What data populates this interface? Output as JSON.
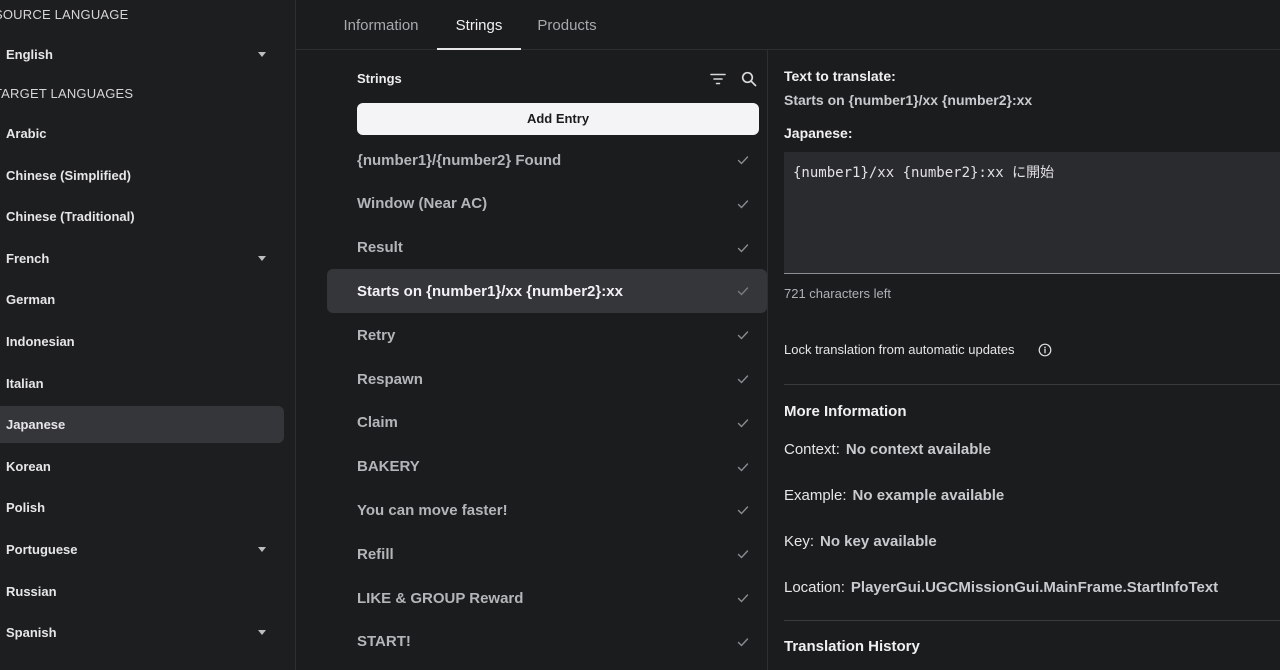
{
  "sidebar": {
    "source_label": "SOURCE LANGUAGE",
    "source_language": "English",
    "target_label": "TARGET LANGUAGES",
    "languages": [
      {
        "name": "Arabic",
        "expandable": false
      },
      {
        "name": "Chinese (Simplified)",
        "expandable": false
      },
      {
        "name": "Chinese (Traditional)",
        "expandable": false
      },
      {
        "name": "French",
        "expandable": true
      },
      {
        "name": "German",
        "expandable": false
      },
      {
        "name": "Indonesian",
        "expandable": false
      },
      {
        "name": "Italian",
        "expandable": false
      },
      {
        "name": "Japanese",
        "expandable": false,
        "selected": true
      },
      {
        "name": "Korean",
        "expandable": false
      },
      {
        "name": "Polish",
        "expandable": false
      },
      {
        "name": "Portuguese",
        "expandable": true
      },
      {
        "name": "Russian",
        "expandable": false
      },
      {
        "name": "Spanish",
        "expandable": true
      }
    ]
  },
  "tabs": [
    {
      "label": "Information",
      "active": false
    },
    {
      "label": "Strings",
      "active": true
    },
    {
      "label": "Products",
      "active": false
    }
  ],
  "strings_panel": {
    "title": "Strings",
    "filter_icon": "filter-icon",
    "search_icon": "search-icon",
    "add_entry_label": "Add Entry",
    "items": [
      {
        "text": "{number1}/{number2} Found",
        "selected": false
      },
      {
        "text": "Window (Near AC)",
        "selected": false
      },
      {
        "text": "Result",
        "selected": false
      },
      {
        "text": "Starts on {number1}/xx {number2}:xx",
        "selected": true
      },
      {
        "text": "Retry",
        "selected": false
      },
      {
        "text": "Respawn",
        "selected": false
      },
      {
        "text": "Claim",
        "selected": false
      },
      {
        "text": "BAKERY",
        "selected": false
      },
      {
        "text": "You can move faster!",
        "selected": false
      },
      {
        "text": "Refill",
        "selected": false
      },
      {
        "text": "LIKE & GROUP Reward",
        "selected": false
      },
      {
        "text": "START!",
        "selected": false
      }
    ]
  },
  "detail": {
    "text_to_translate_label": "Text to translate:",
    "text_to_translate": "Starts on {number1}/xx {number2}:xx",
    "target_label": "Japanese:",
    "translation_value": "{number1}/xx {number2}:xx に開始",
    "chars_left": "721 characters left",
    "lock_label": "Lock translation from automatic updates",
    "more_info_title": "More Information",
    "context_key": "Context:",
    "context_value": "No context available",
    "example_key": "Example:",
    "example_value": "No example available",
    "key_key": "Key:",
    "key_value": "No key available",
    "location_key": "Location:",
    "location_value": "PlayerGui.UGCMissionGui.MainFrame.StartInfoText",
    "history_title": "Translation History"
  }
}
